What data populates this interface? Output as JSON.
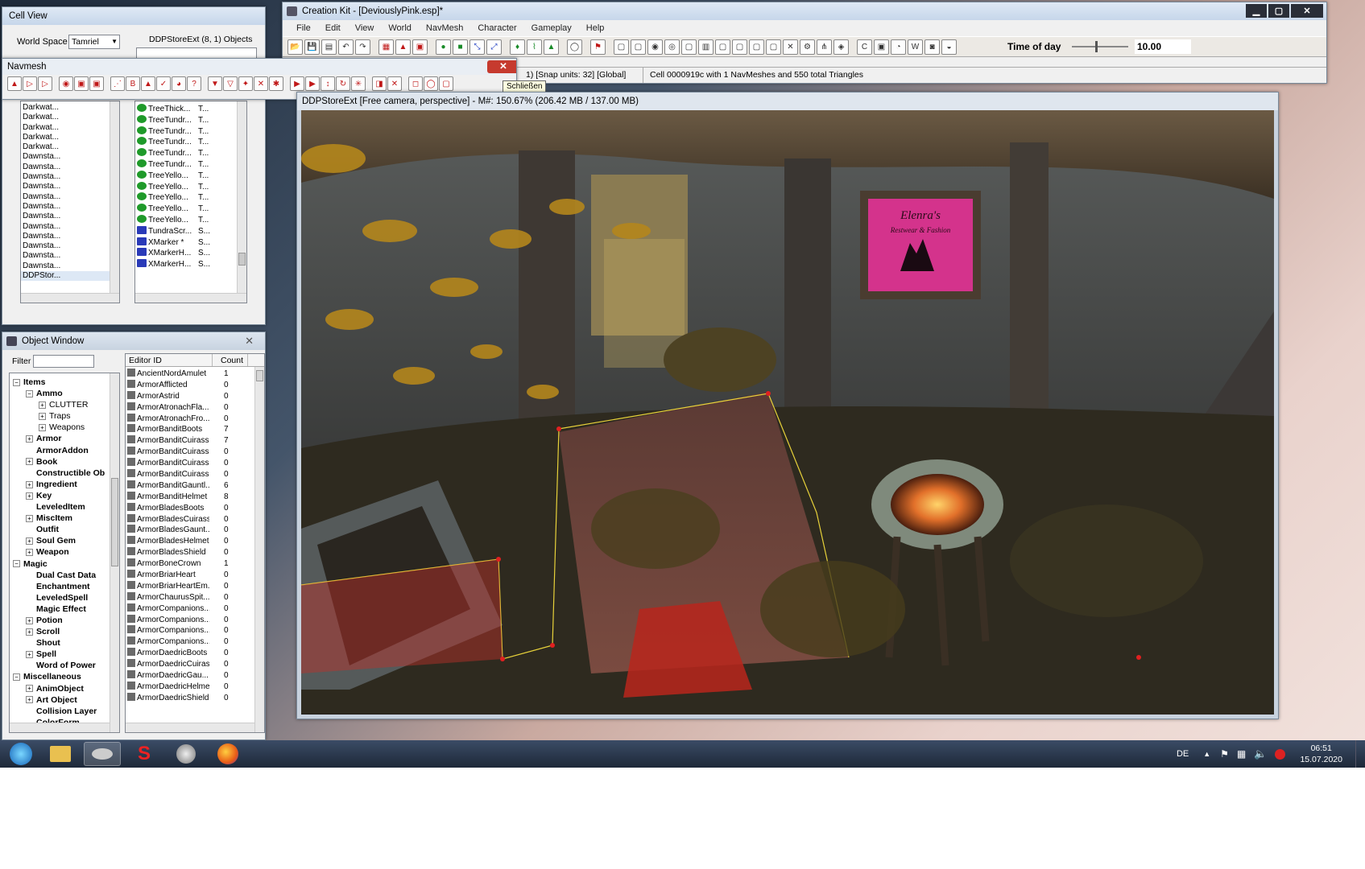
{
  "cell_view": {
    "title": "Cell View",
    "world_space_label": "World Space",
    "world_space_value": "Tamriel",
    "cell_header": "DDPStoreExt (8, 1) Objects",
    "cells": [
      "Darkwat...",
      "Darkwat...",
      "Darkwat...",
      "Darkwat...",
      "Darkwat...",
      "Dawnsta...",
      "Dawnsta...",
      "Dawnsta...",
      "Dawnsta...",
      "Dawnsta...",
      "Dawnsta...",
      "Dawnsta...",
      "Dawnsta...",
      "Dawnsta...",
      "Dawnsta...",
      "Dawnsta...",
      "Dawnsta...",
      "DDPStor..."
    ],
    "objects": [
      {
        "name": "TreeThick...",
        "type": "T..."
      },
      {
        "name": "TreeTundr...",
        "type": "T..."
      },
      {
        "name": "TreeTundr...",
        "type": "T..."
      },
      {
        "name": "TreeTundr...",
        "type": "T..."
      },
      {
        "name": "TreeTundr...",
        "type": "T..."
      },
      {
        "name": "TreeTundr...",
        "type": "T..."
      },
      {
        "name": "TreeYello...",
        "type": "T..."
      },
      {
        "name": "TreeYello...",
        "type": "T..."
      },
      {
        "name": "TreeYello...",
        "type": "T..."
      },
      {
        "name": "TreeYello...",
        "type": "T..."
      },
      {
        "name": "TreeYello...",
        "type": "T..."
      },
      {
        "name": "TundraScr...",
        "type": "S..."
      },
      {
        "name": "XMarker *",
        "type": "S..."
      },
      {
        "name": "XMarkerH...",
        "type": "S..."
      },
      {
        "name": "XMarkerH...",
        "type": "S..."
      }
    ]
  },
  "navmesh": {
    "title": "Navmesh",
    "close_tooltip": "Schließen"
  },
  "main": {
    "title": "Creation Kit - [DeviouslyPink.esp]*",
    "menu": [
      "File",
      "Edit",
      "View",
      "World",
      "NavMesh",
      "Character",
      "Gameplay",
      "Help"
    ],
    "time_of_day_label": "Time of day",
    "time_of_day_value": "10.00",
    "time_of_day_fraction": 0.42,
    "status_left": "1) [Snap units: 32] [Global]",
    "status_right": "Cell 0000919c with 1 NavMeshes and 550 total Triangles"
  },
  "viewport": {
    "title": "DDPStoreExt [Free camera, perspective] - M#: 150.67% (206.42 MB / 137.00 MB)"
  },
  "object_window": {
    "title": "Object Window",
    "filter_label": "Filter",
    "col_editor_id": "Editor ID",
    "col_count": "Count",
    "tree": [
      {
        "label": "Items",
        "level": 0,
        "sign": "−"
      },
      {
        "label": "Ammo",
        "level": 1,
        "sign": "−"
      },
      {
        "label": "CLUTTER",
        "level": 2,
        "sign": "+",
        "sub": true
      },
      {
        "label": "Traps",
        "level": 2,
        "sign": "+",
        "sub": true
      },
      {
        "label": "Weapons",
        "level": 2,
        "sign": "+",
        "sub": true
      },
      {
        "label": "Armor",
        "level": 1,
        "sign": "+"
      },
      {
        "label": "ArmorAddon",
        "level": 1,
        "sign": ""
      },
      {
        "label": "Book",
        "level": 1,
        "sign": "+"
      },
      {
        "label": "Constructible Ob",
        "level": 1,
        "sign": ""
      },
      {
        "label": "Ingredient",
        "level": 1,
        "sign": "+"
      },
      {
        "label": "Key",
        "level": 1,
        "sign": "+"
      },
      {
        "label": "LeveledItem",
        "level": 1,
        "sign": ""
      },
      {
        "label": "MiscItem",
        "level": 1,
        "sign": "+"
      },
      {
        "label": "Outfit",
        "level": 1,
        "sign": ""
      },
      {
        "label": "Soul Gem",
        "level": 1,
        "sign": "+"
      },
      {
        "label": "Weapon",
        "level": 1,
        "sign": "+"
      },
      {
        "label": "Magic",
        "level": 0,
        "sign": "−"
      },
      {
        "label": "Dual Cast Data",
        "level": 1,
        "sign": ""
      },
      {
        "label": "Enchantment",
        "level": 1,
        "sign": ""
      },
      {
        "label": "LeveledSpell",
        "level": 1,
        "sign": ""
      },
      {
        "label": "Magic Effect",
        "level": 1,
        "sign": ""
      },
      {
        "label": "Potion",
        "level": 1,
        "sign": "+"
      },
      {
        "label": "Scroll",
        "level": 1,
        "sign": "+"
      },
      {
        "label": "Shout",
        "level": 1,
        "sign": ""
      },
      {
        "label": "Spell",
        "level": 1,
        "sign": "+"
      },
      {
        "label": "Word of Power",
        "level": 1,
        "sign": ""
      },
      {
        "label": "Miscellaneous",
        "level": 0,
        "sign": "−"
      },
      {
        "label": "AnimObject",
        "level": 1,
        "sign": "+"
      },
      {
        "label": "Art Object",
        "level": 1,
        "sign": "+"
      },
      {
        "label": "Collision Layer",
        "level": 1,
        "sign": ""
      },
      {
        "label": "ColorForm",
        "level": 1,
        "sign": ""
      }
    ],
    "rows": [
      {
        "id": "AncientNordAmulet",
        "count": "1"
      },
      {
        "id": "ArmorAfflicted",
        "count": "0"
      },
      {
        "id": "ArmorAstrid",
        "count": "0"
      },
      {
        "id": "ArmorAtronachFla...",
        "count": "0"
      },
      {
        "id": "ArmorAtronachFro...",
        "count": "0"
      },
      {
        "id": "ArmorBanditBoots",
        "count": "7"
      },
      {
        "id": "ArmorBanditCuirass",
        "count": "7"
      },
      {
        "id": "ArmorBanditCuirass1",
        "count": "0"
      },
      {
        "id": "ArmorBanditCuirass2",
        "count": "0"
      },
      {
        "id": "ArmorBanditCuirass3",
        "count": "0"
      },
      {
        "id": "ArmorBanditGauntl...",
        "count": "6"
      },
      {
        "id": "ArmorBanditHelmet",
        "count": "8"
      },
      {
        "id": "ArmorBladesBoots",
        "count": "0"
      },
      {
        "id": "ArmorBladesCuirass",
        "count": "0"
      },
      {
        "id": "ArmorBladesGaunt...",
        "count": "0"
      },
      {
        "id": "ArmorBladesHelmet",
        "count": "0"
      },
      {
        "id": "ArmorBladesShield",
        "count": "0"
      },
      {
        "id": "ArmorBoneCrown",
        "count": "1"
      },
      {
        "id": "ArmorBriarHeart",
        "count": "0"
      },
      {
        "id": "ArmorBriarHeartEm...",
        "count": "0"
      },
      {
        "id": "ArmorChaurusSpit...",
        "count": "0"
      },
      {
        "id": "ArmorCompanions...",
        "count": "0"
      },
      {
        "id": "ArmorCompanions...",
        "count": "0"
      },
      {
        "id": "ArmorCompanions...",
        "count": "0"
      },
      {
        "id": "ArmorCompanions...",
        "count": "0"
      },
      {
        "id": "ArmorDaedricBoots",
        "count": "0"
      },
      {
        "id": "ArmorDaedricCuirass",
        "count": "0"
      },
      {
        "id": "ArmorDaedricGau...",
        "count": "0"
      },
      {
        "id": "ArmorDaedricHelmet",
        "count": "0"
      },
      {
        "id": "ArmorDaedricShield",
        "count": "0"
      }
    ]
  },
  "taskbar": {
    "language": "DE",
    "time": "06:51",
    "date": "15.07.2020"
  },
  "scene": {
    "sign_line1": "Elenra's",
    "sign_line2": "Restwear & Fashion"
  },
  "colors": {
    "navmesh_edge": "#e8d23a",
    "navmesh_fill": "#c0302a",
    "sign_pink": "#d4338c"
  }
}
